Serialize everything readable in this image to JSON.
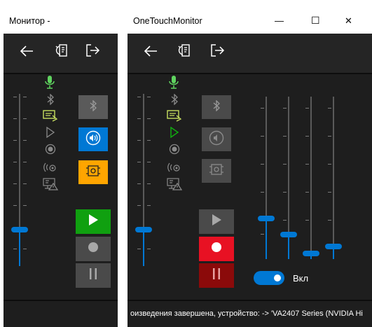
{
  "left_window": {
    "title": "Монитор -",
    "nav": {
      "back_icon": "back-arrow-icon",
      "refresh_icon": "device-refresh-icon",
      "exit_icon": "exit-icon"
    },
    "volume_level": 0.2
  },
  "right_window": {
    "title": "OneTouchMonitor",
    "window_controls": {
      "minimize": "—",
      "maximize": "☐",
      "close": "✕"
    },
    "main_volume_level": 0.2,
    "channel_levels": [
      0.3,
      0.15,
      0.05,
      0.1
    ],
    "toggle_label": "Вкл",
    "status_text": "оизведения завершена, устройство: -> 'VA2407 Series (NVIDIA Hi"
  },
  "colors": {
    "accent_blue": "#0078d4",
    "green": "#10a010",
    "red": "#e81123",
    "dark_red": "#8b0a0a",
    "orange": "#ffa500",
    "mic_green": "#5fd35f",
    "icon_gray": "#8a8a8a"
  }
}
